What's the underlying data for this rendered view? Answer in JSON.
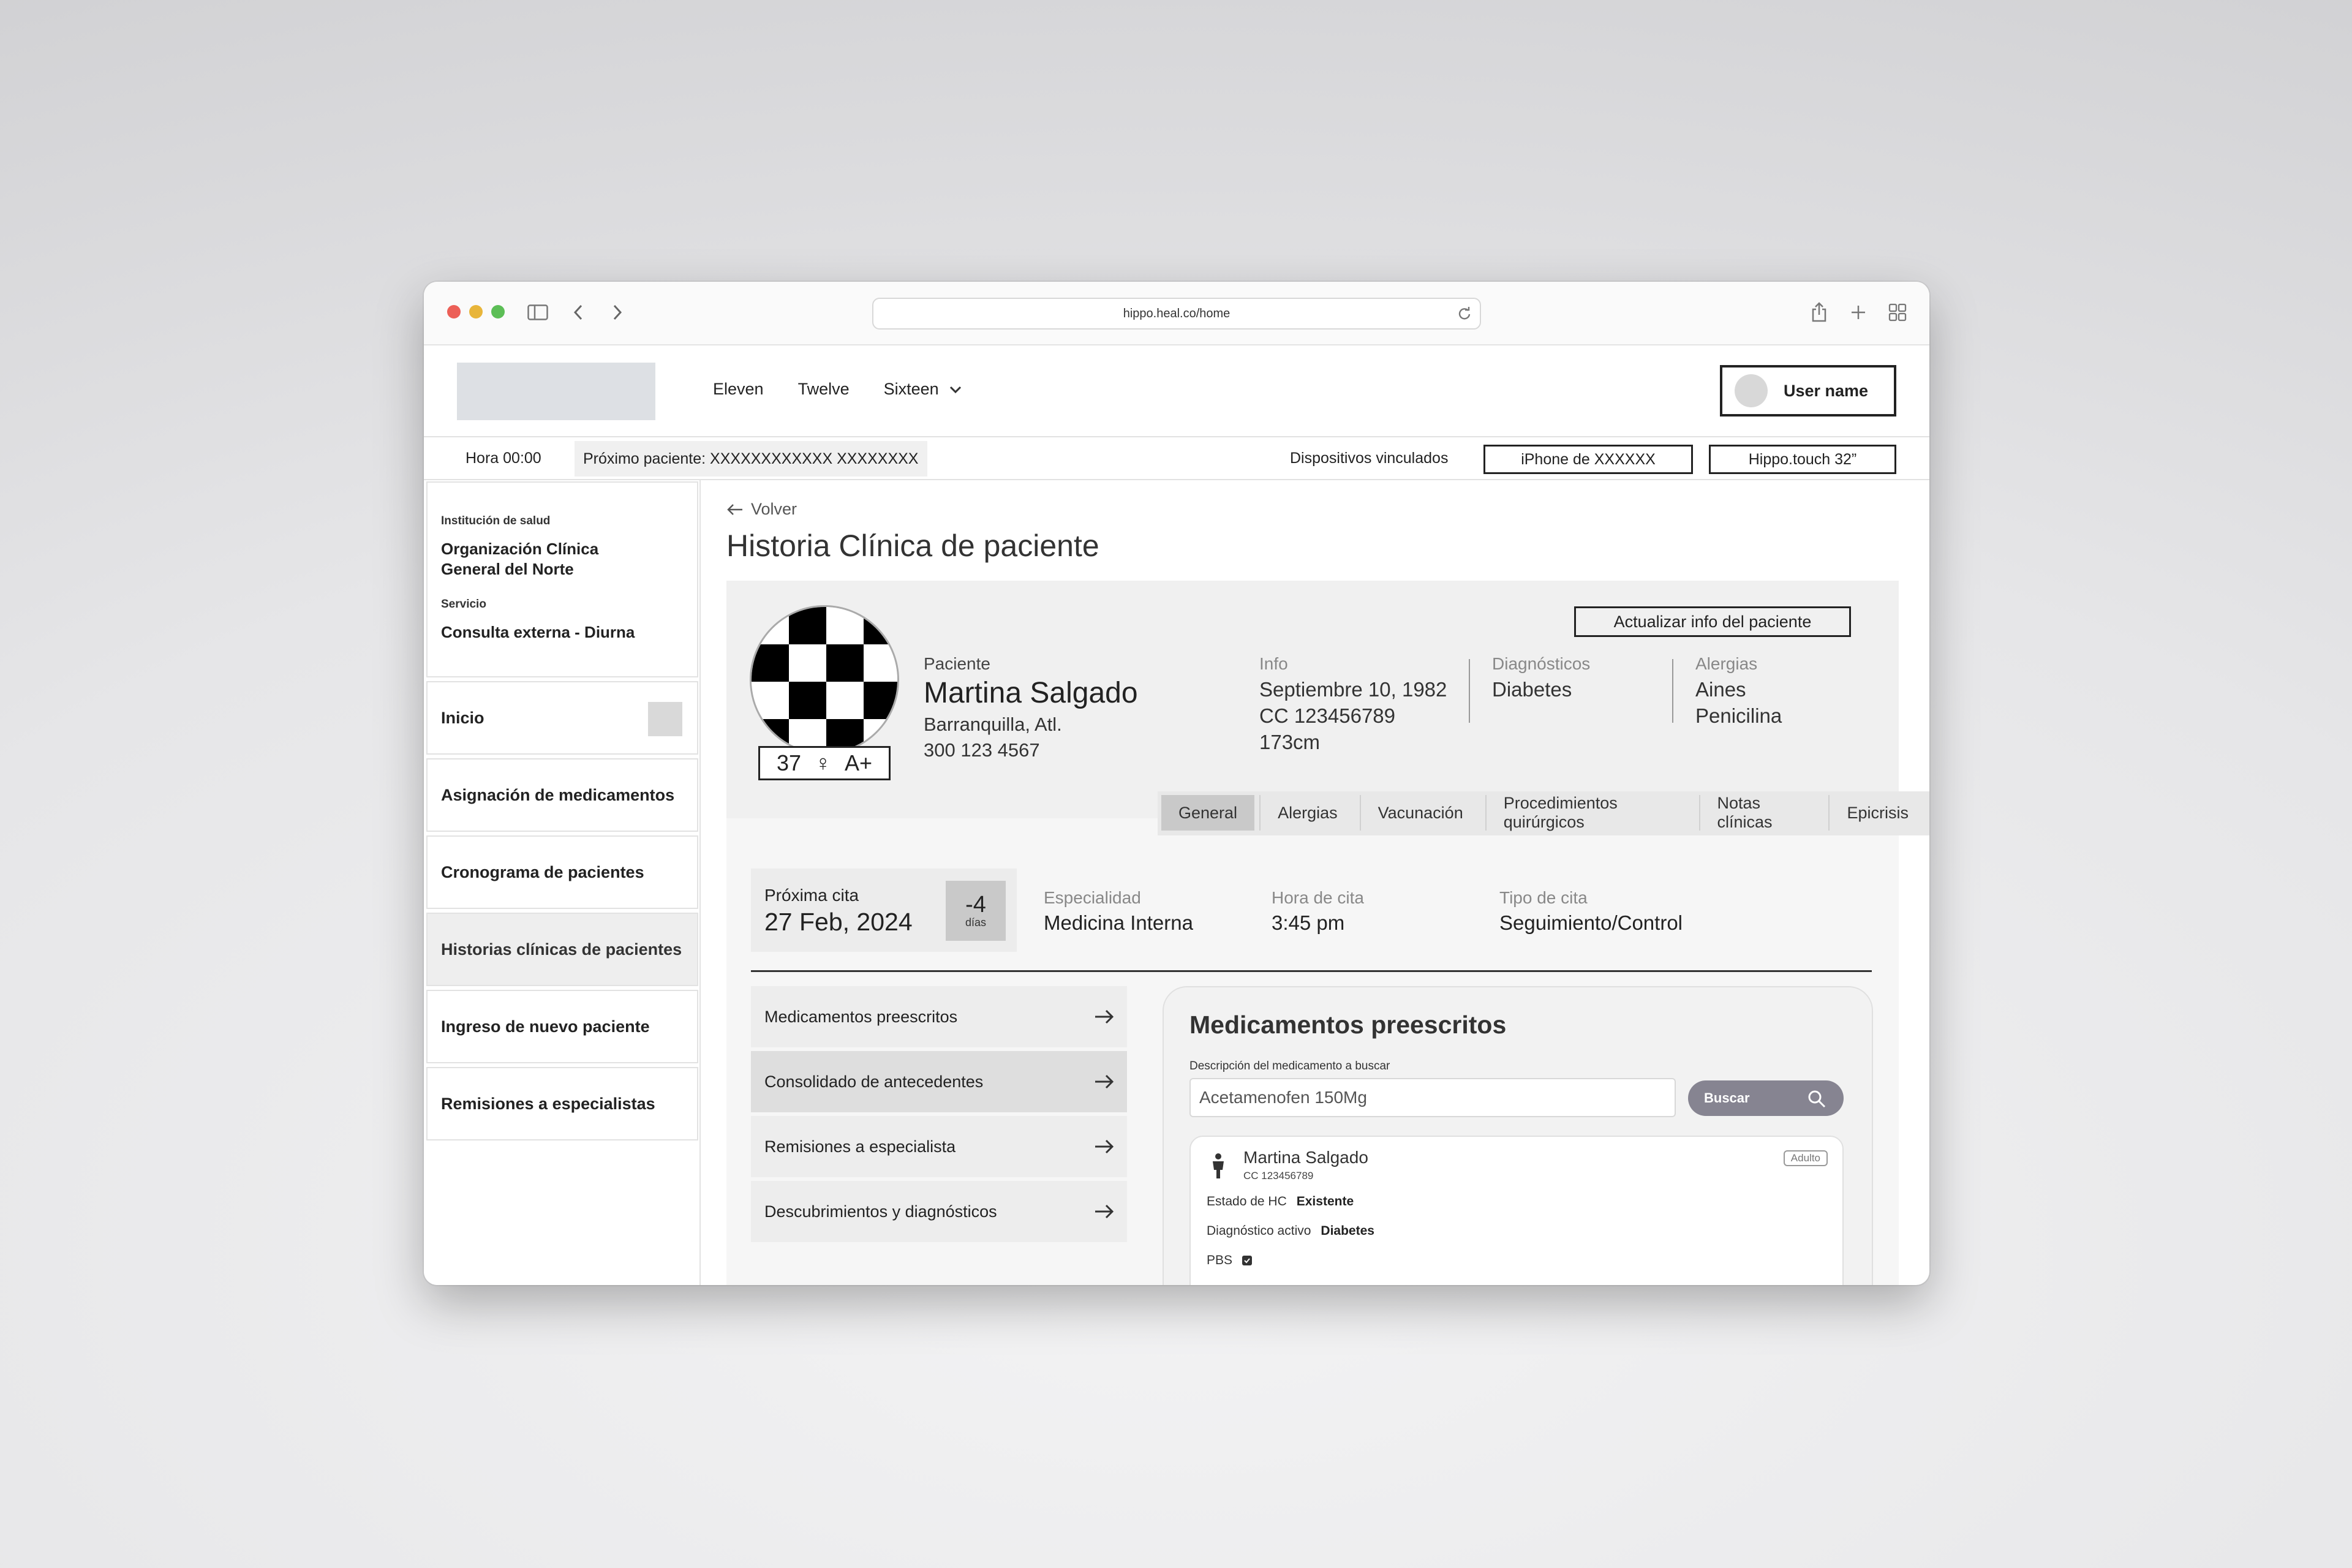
{
  "browser": {
    "url": "hippo.heal.co/home"
  },
  "header": {
    "nav": [
      "Eleven",
      "Twelve",
      "Sixteen"
    ],
    "user_name": "User name"
  },
  "status": {
    "hora": "Hora 00:00",
    "proximo": "Próximo paciente: XXXXXXXXXXXX XXXXXXXX",
    "dispositivos_label": "Dispositivos vinculados",
    "devices": [
      "iPhone de XXXXXX",
      "Hippo.touch 32”"
    ]
  },
  "sidebar": {
    "institucion_label": "Institución de salud",
    "institucion_line1": "Organización Clínica",
    "institucion_line2": "General del Norte",
    "servicio_label": "Servicio",
    "servicio_value": "Consulta externa - Diurna",
    "items": [
      "Inicio",
      "Asignación de medicamentos",
      "Cronograma de pacientes",
      "Historias clínicas de pacientes",
      "Ingreso de nuevo paciente",
      "Remisiones a especialistas"
    ]
  },
  "page": {
    "back": "Volver",
    "title": "Historia Clínica de paciente",
    "update_button": "Actualizar info del paciente"
  },
  "patient": {
    "label": "Paciente",
    "name": "Martina Salgado",
    "city": "Barranquilla, Atl.",
    "phone": "300 123 4567",
    "age": "37",
    "sex_symbol": "♀",
    "blood": "A+",
    "info_label": "Info",
    "info_lines": [
      "Septiembre 10, 1982",
      "CC 123456789",
      "173cm"
    ],
    "diag_label": "Diagnósticos",
    "diag_lines": [
      "Diabetes"
    ],
    "alerg_label": "Alergias",
    "alerg_lines": [
      "Aines",
      "Penicilina"
    ]
  },
  "tabs": [
    "General",
    "Alergias",
    "Vacunación",
    "Procedimientos quirúrgicos",
    "Notas clínicas",
    "Epicrisis"
  ],
  "cita": {
    "label": "Próxima cita",
    "date": "27 Feb, 2024",
    "days_num": "-4",
    "days_label": "días",
    "especialidad_label": "Especialidad",
    "especialidad": "Medicina Interna",
    "hora_label": "Hora de cita",
    "hora": "3:45 pm",
    "tipo_label": "Tipo de cita",
    "tipo": "Seguimiento/Control"
  },
  "menu": [
    "Medicamentos preescritos",
    "Consolidado de antecedentes",
    "Remisiones a especialista",
    "Descubrimientos y diagnósticos"
  ],
  "med_panel": {
    "title": "Medicamentos preescritos",
    "field_label": "Descripción del medicamento a buscar",
    "field_value": "Acetamenofen 150Mg",
    "search_button": "Buscar",
    "card": {
      "name": "Martina Salgado",
      "cc": "CC 123456789",
      "tag": "Adulto",
      "estado_label": "Estado de HC",
      "estado_value": "Existente",
      "diag_label": "Diagnóstico activo",
      "diag_value": "Diabetes",
      "pbs_label": "PBS"
    }
  }
}
